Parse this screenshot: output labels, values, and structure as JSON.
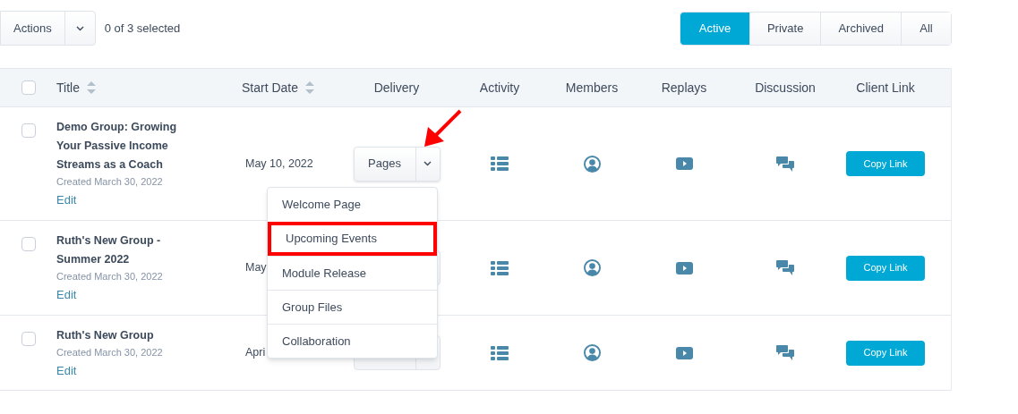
{
  "toolbar": {
    "actions_label": "Actions",
    "selection_count": "0 of 3 selected"
  },
  "filter_tabs": [
    {
      "label": "Active",
      "selected": true
    },
    {
      "label": "Private",
      "selected": false
    },
    {
      "label": "Archived",
      "selected": false
    },
    {
      "label": "All",
      "selected": false
    }
  ],
  "table": {
    "select_all_checked": false,
    "columns": [
      "Title",
      "Start Date",
      "Delivery",
      "Activity",
      "Members",
      "Replays",
      "Discussion",
      "Client Link"
    ],
    "rows": [
      {
        "checked": false,
        "title": "Demo Group: Growing Your Passive Income Streams as a Coach",
        "created": "Created March 30, 2022",
        "edit": "Edit",
        "start_date": "May 10, 2022",
        "delivery": "Pages",
        "delivery_open": true,
        "client_link": "Copy Link"
      },
      {
        "checked": false,
        "title": "Ruth's New Group - Summer 2022",
        "created": "Created March 30, 2022",
        "edit": "Edit",
        "start_date": "May",
        "client_link": "Copy Link"
      },
      {
        "checked": false,
        "title": "Ruth's New Group",
        "created": "Created March 30, 2022",
        "edit": "Edit",
        "start_date": "Apri",
        "client_link": "Copy Link"
      }
    ]
  },
  "delivery_menu": {
    "items": [
      {
        "label": "Welcome Page",
        "highlighted": false
      },
      {
        "label": "Upcoming Events",
        "highlighted": true
      },
      {
        "label": "Module Release",
        "highlighted": false
      },
      {
        "label": "Group Files",
        "highlighted": false
      },
      {
        "label": "Collaboration",
        "highlighted": false
      }
    ]
  }
}
